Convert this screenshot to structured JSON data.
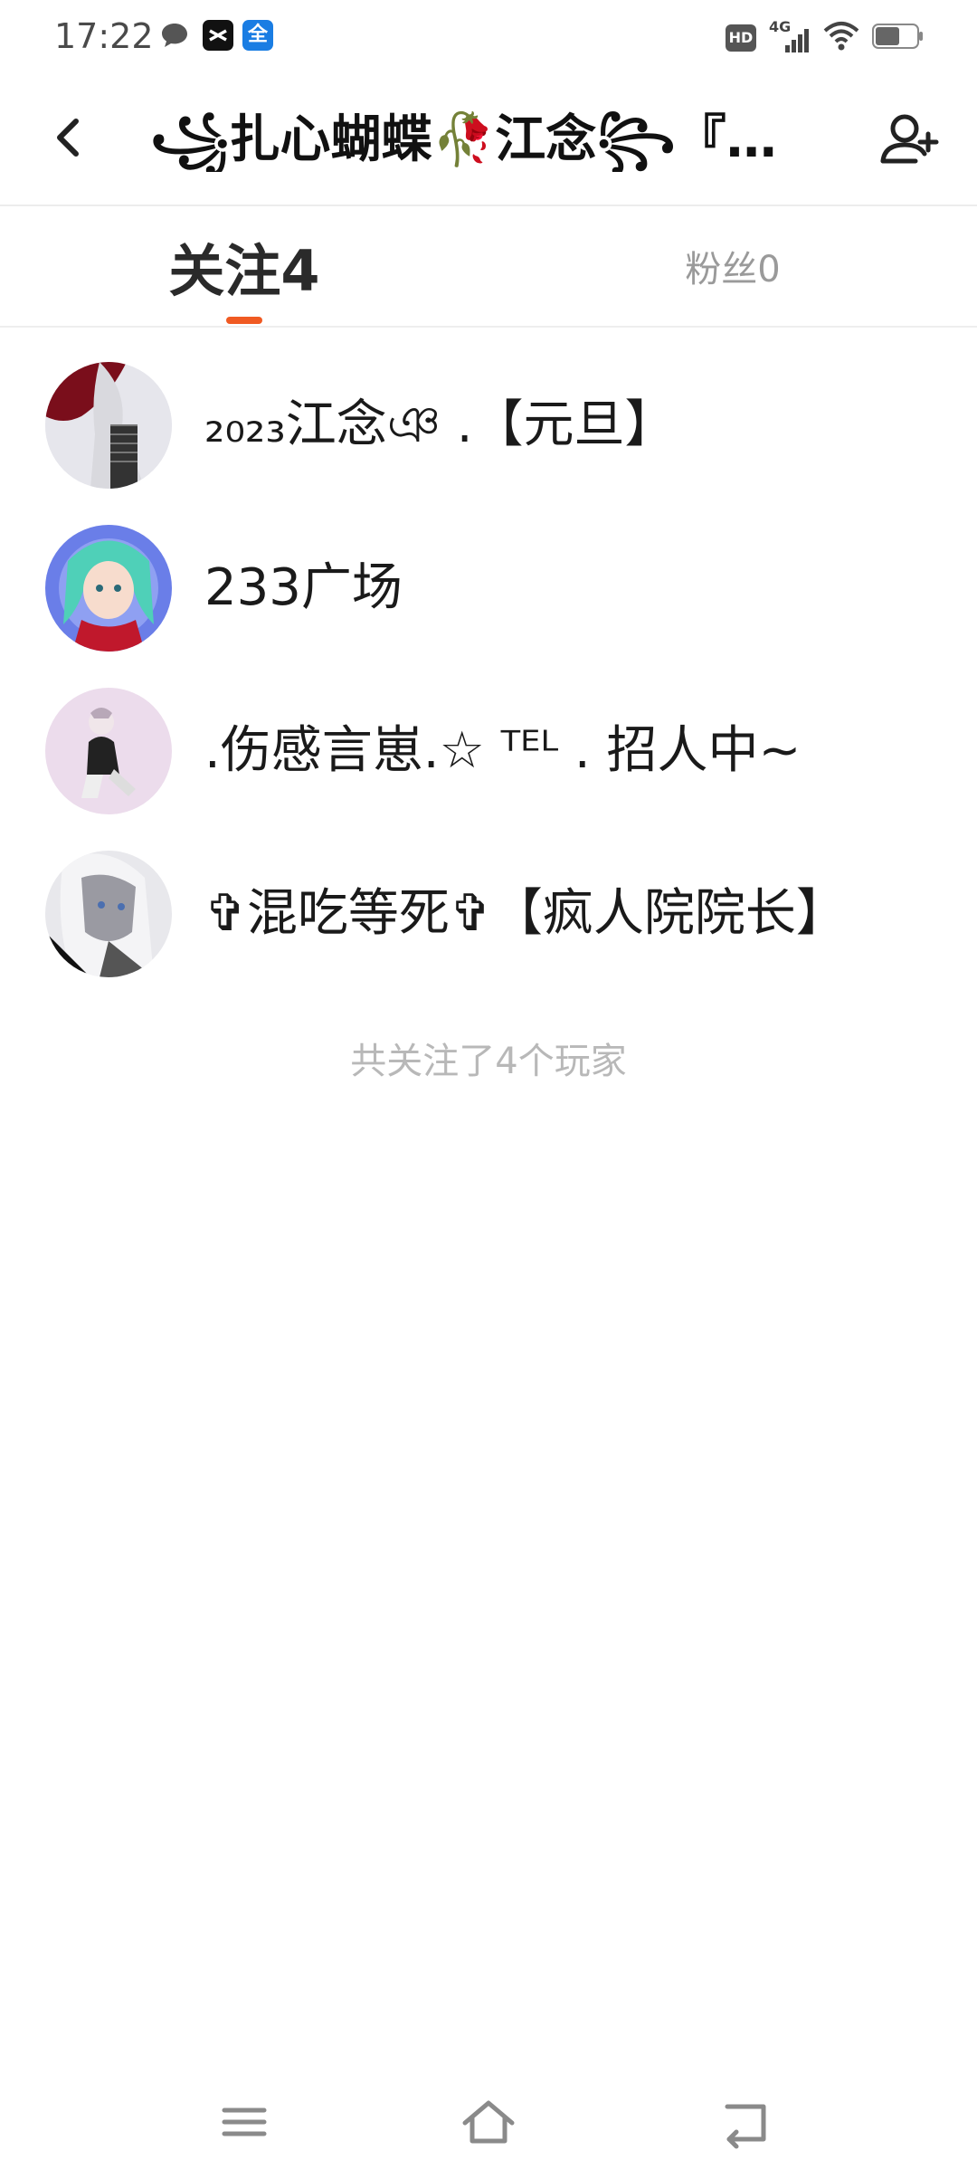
{
  "status_bar": {
    "time": "17:22",
    "notification_icons": [
      "chat-bubble-icon",
      "capcut-app-icon",
      "full-app-icon"
    ],
    "right_icons": [
      "hd-icon",
      "signal-4g-icon",
      "wifi-icon",
      "battery-icon"
    ],
    "hd_label": "HD",
    "network_label": "4G"
  },
  "header": {
    "title": "꧁扎心蝴蝶🥀江念꧂『…"
  },
  "tabs": [
    {
      "label": "关注4",
      "active": true
    },
    {
      "label": "粉丝0",
      "active": false
    }
  ],
  "follow_list": [
    {
      "name": "₂₀₂₃江念ঞ .【元旦】"
    },
    {
      "name": "233广场"
    },
    {
      "name": ".伤感言崽.☆ ᵀᴱᴸ . 招人中~"
    },
    {
      "name": "✞混吃等死✞【疯人院院长】"
    }
  ],
  "footer_note": "共关注了4个玩家",
  "colors": {
    "accent": "#f05a22",
    "active_tab_text": "#2a2a2a",
    "inactive_tab_text": "#9a9a9a",
    "footer_text": "#b8b8b8"
  },
  "navbar": {
    "buttons": [
      "menu-icon",
      "home-icon",
      "back-nav-icon"
    ]
  }
}
